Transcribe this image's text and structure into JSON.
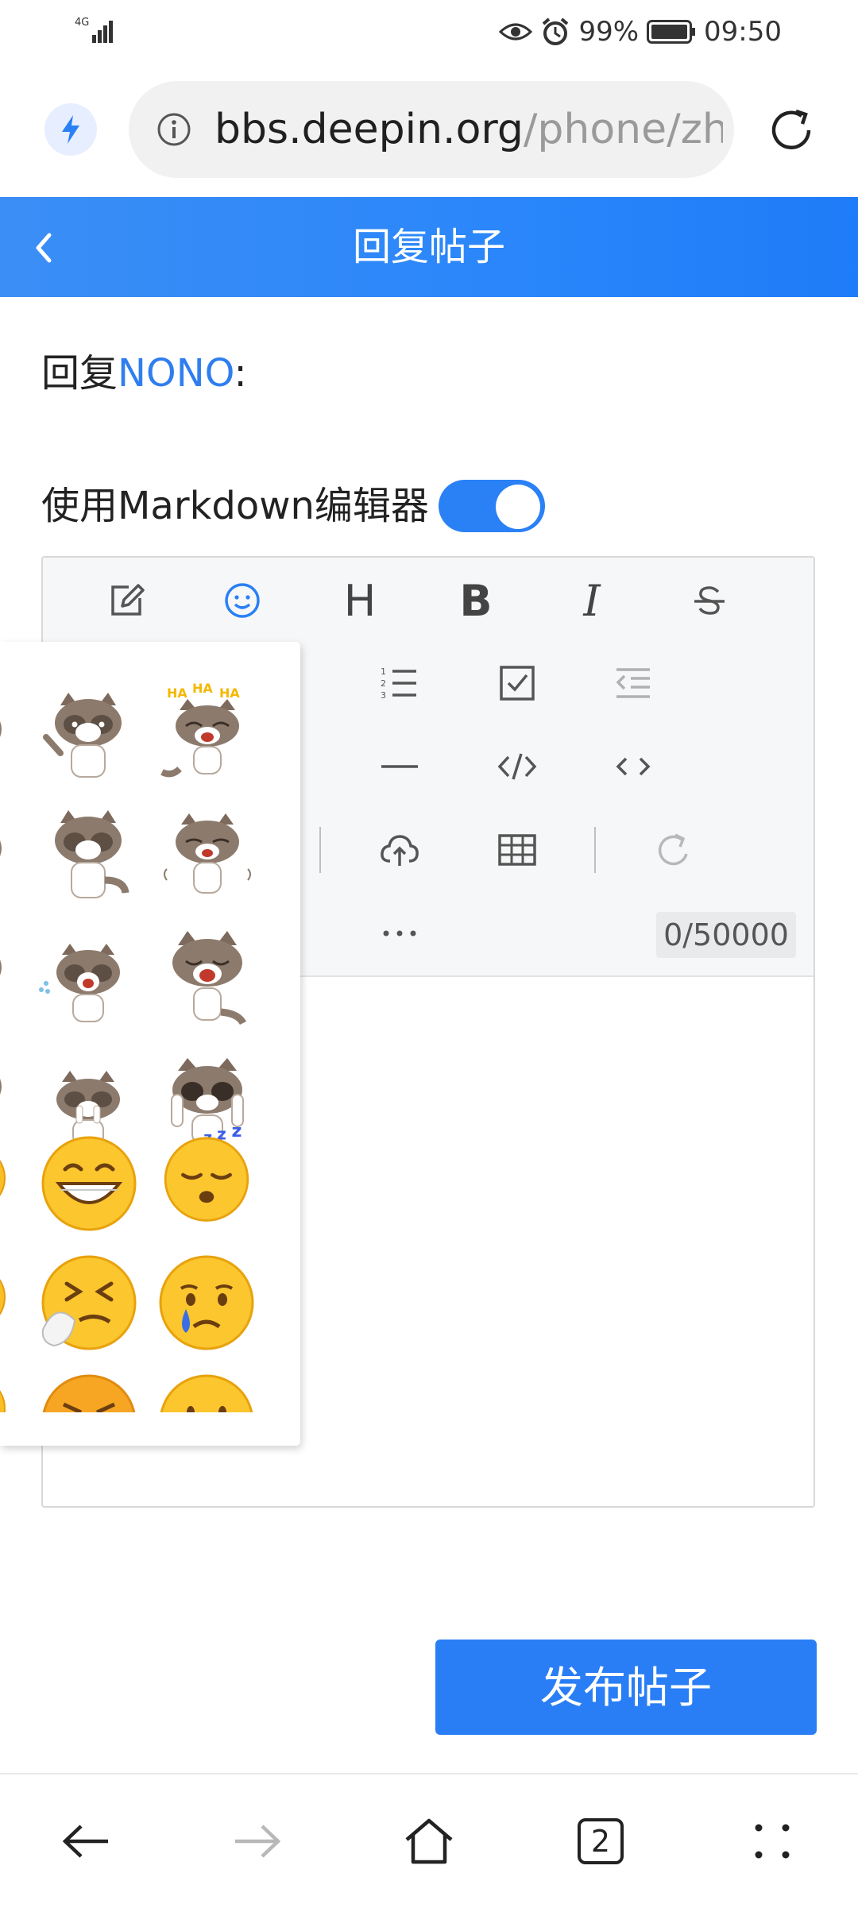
{
  "status_bar": {
    "network": "4G",
    "battery": "99%",
    "time": "09:50"
  },
  "address_bar": {
    "url_host": "bbs.deepin.org",
    "url_path": "/phone/zh"
  },
  "header": {
    "title": "回复帖子"
  },
  "reply": {
    "prefix": "回复",
    "user": "NONO",
    "suffix": ":"
  },
  "markdown_toggle": {
    "label": "使用Markdown编辑器",
    "enabled": true
  },
  "editor": {
    "toolbar_row1": [
      "edit-icon",
      "emoji-icon",
      "heading-icon",
      "bold-icon",
      "italic-icon",
      "strikethrough-icon"
    ],
    "heading_label": "H",
    "bold_label": "B",
    "italic_label": "I",
    "counter": "0/50000"
  },
  "emoji_panel": {
    "stickers": [
      "raccoon-wave",
      "raccoon-laugh",
      "raccoon-shy",
      "raccoon-smug",
      "raccoon-sweat",
      "raccoon-cry",
      "raccoon-scared",
      "raccoon-facepalm"
    ],
    "emojis": [
      "grinning-face",
      "sleeping-face",
      "sneezing-face",
      "crying-face",
      "angry-face",
      "neutral-face"
    ]
  },
  "actions": {
    "publish_label": "发布帖子"
  },
  "bottom_nav": {
    "tab_count": "2"
  },
  "colors": {
    "accent": "#2a80f5",
    "header_start": "#3b8ef5",
    "header_end": "#1f7cf8",
    "user_link": "#2f7ef0"
  }
}
